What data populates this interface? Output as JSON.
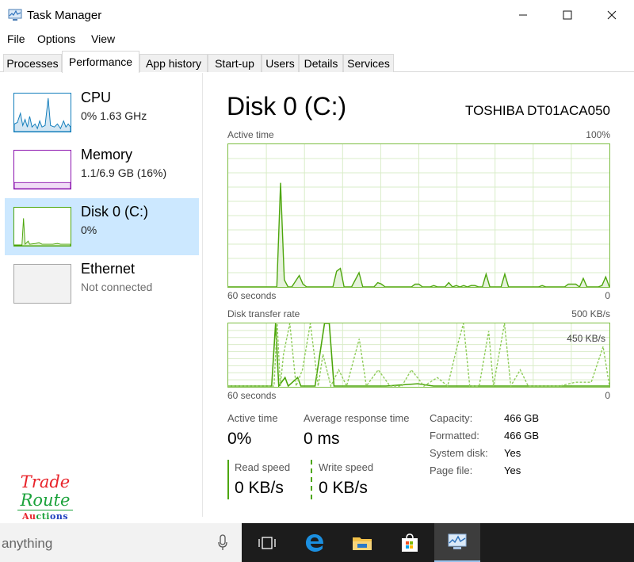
{
  "window": {
    "title": "Task Manager",
    "controls": {
      "minimize": "—",
      "maximize": "☐",
      "close": "✕"
    }
  },
  "menu": [
    "File",
    "Options",
    "View"
  ],
  "tabs": [
    "Processes",
    "Performance",
    "App history",
    "Start-up",
    "Users",
    "Details",
    "Services"
  ],
  "active_tab": "Performance",
  "sidebar": {
    "items": [
      {
        "name": "CPU",
        "sub": "0%  1.63 GHz",
        "color": "#117dbb"
      },
      {
        "name": "Memory",
        "sub": "1.1/6.9 GB (16%)",
        "color": "#8b12ae"
      },
      {
        "name": "Disk 0 (C:)",
        "sub": "0%",
        "color": "#4da60c"
      },
      {
        "name": "Ethernet",
        "sub": "Not connected",
        "color": "#a7a7a7"
      }
    ],
    "selected": "Disk 0 (C:)"
  },
  "logo": {
    "line1": "Trade",
    "line2": "Route",
    "line3": "Auctions"
  },
  "disk": {
    "title": "Disk 0 (C:)",
    "model": "TOSHIBA DT01ACA050",
    "active_graph": {
      "label": "Active time",
      "max_label": "100%",
      "time_label": "60 seconds",
      "min_label": "0",
      "values": [
        0,
        0,
        0,
        0,
        0,
        0,
        0,
        0,
        0,
        0,
        0,
        0,
        0,
        0,
        73,
        5,
        0,
        0,
        4,
        8,
        2,
        0,
        0,
        0,
        0,
        0,
        0,
        0,
        0,
        11,
        13,
        0,
        0,
        0,
        5,
        10,
        0,
        0,
        0,
        0,
        3,
        2,
        0,
        0,
        0,
        0,
        0,
        0,
        0,
        0,
        2,
        2,
        0,
        0,
        0,
        1,
        0,
        0,
        0,
        3,
        0,
        1,
        0,
        1,
        0,
        1,
        1,
        0,
        0,
        9,
        0,
        0,
        0,
        0,
        9,
        0,
        0,
        0,
        0,
        0,
        0,
        0,
        0,
        0,
        1,
        0,
        0,
        0,
        0,
        0,
        0,
        2,
        2,
        2,
        0,
        6,
        0,
        0,
        0,
        0,
        1,
        7,
        0
      ]
    },
    "transfer_graph": {
      "label": "Disk transfer rate",
      "max_label": "500 KB/s",
      "inner_label": "450 KB/s",
      "time_label": "60 seconds",
      "min_label": "0"
    },
    "stats": {
      "active_time_label": "Active time",
      "active_time_value": "0%",
      "response_label": "Average response time",
      "response_value": "0 ms",
      "read_label": "Read speed",
      "read_value": "0 KB/s",
      "write_label": "Write speed",
      "write_value": "0 KB/s"
    },
    "properties": [
      {
        "key": "Capacity:",
        "value": "466 GB"
      },
      {
        "key": "Formatted:",
        "value": "466 GB"
      },
      {
        "key": "System disk:",
        "value": "Yes"
      },
      {
        "key": "Page file:",
        "value": "Yes"
      }
    ],
    "accent": "#4da60c"
  },
  "taskbar": {
    "search_text": "anything",
    "icons": [
      "microphone-icon",
      "task-view-icon",
      "edge-icon",
      "file-explorer-icon",
      "store-icon",
      "task-manager-icon"
    ]
  }
}
